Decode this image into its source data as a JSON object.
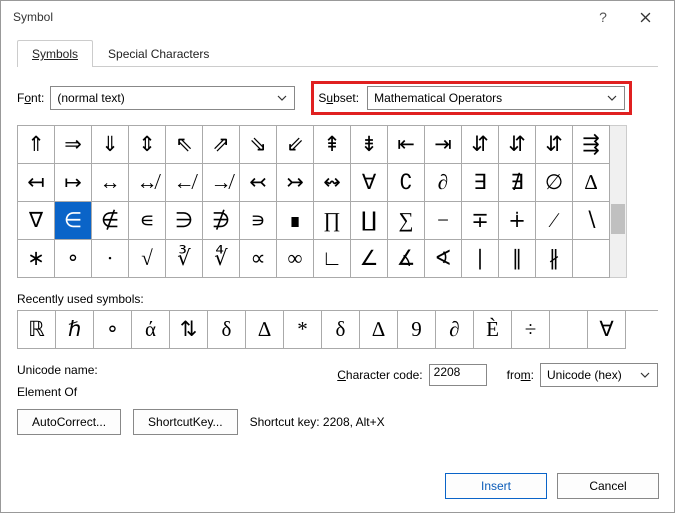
{
  "title": "Symbol",
  "tabs": {
    "symbols": "Symbols",
    "special": "Special Characters"
  },
  "font_label_pre": "F",
  "font_label_ul": "o",
  "font_label_post": "nt:",
  "font_value": "(normal text)",
  "subset_label_pre": "S",
  "subset_label_ul": "u",
  "subset_label_post": "bset:",
  "subset_value": "Mathematical Operators",
  "grid": [
    "⇑",
    "⇒",
    "⇓",
    "⇕",
    "⇖",
    "⇗",
    "⇘",
    "⇙",
    "⇞",
    "⇟",
    "⇤",
    "⇥",
    "⇵",
    "⇵",
    "⇵",
    "⇶",
    "↤",
    "↦",
    "↔",
    "↮",
    "↚",
    "↛",
    "↢",
    "↣",
    "↭",
    "∀",
    "∁",
    "∂",
    "∃",
    "∄",
    "∅",
    "∆",
    "∇",
    "∈",
    "∉",
    "∊",
    "∋",
    "∌",
    "∍",
    "∎",
    "∏",
    "∐",
    "∑",
    "−",
    "∓",
    "∔",
    "∕",
    "∖",
    "∗",
    "∘",
    "∙",
    "√",
    "∛",
    "∜",
    "∝",
    "∞",
    "∟",
    "∠",
    "∡",
    "∢",
    "∣",
    "∥",
    "∦"
  ],
  "selected_index": 33,
  "recent_label_ul": "R",
  "recent_label_post": "ecently used symbols:",
  "recent": [
    "ℝ",
    "ℏ",
    "∘",
    "ά",
    "⇅",
    "δ",
    "∆",
    "*",
    "δ",
    "∆",
    "9",
    "∂",
    "È",
    "÷",
    "",
    "∀"
  ],
  "uname_label": "Unicode name:",
  "uname_value": "Element Of",
  "charcode_label_ul": "C",
  "charcode_label_post": "haracter code:",
  "charcode_value": "2208",
  "from_label_pre": "fro",
  "from_label_ul": "m",
  "from_label_post": ":",
  "from_value": "Unicode (hex)",
  "autocorrect_ul": "A",
  "autocorrect_post": "utoCorrect...",
  "shortcutkey_label": "Shortcut ",
  "shortcutkey_ul": "K",
  "shortcutkey_post": "ey...",
  "shortcut_text": "Shortcut key: 2208, Alt+X",
  "insert_ul": "I",
  "insert_post": "nsert",
  "cancel": "Cancel"
}
